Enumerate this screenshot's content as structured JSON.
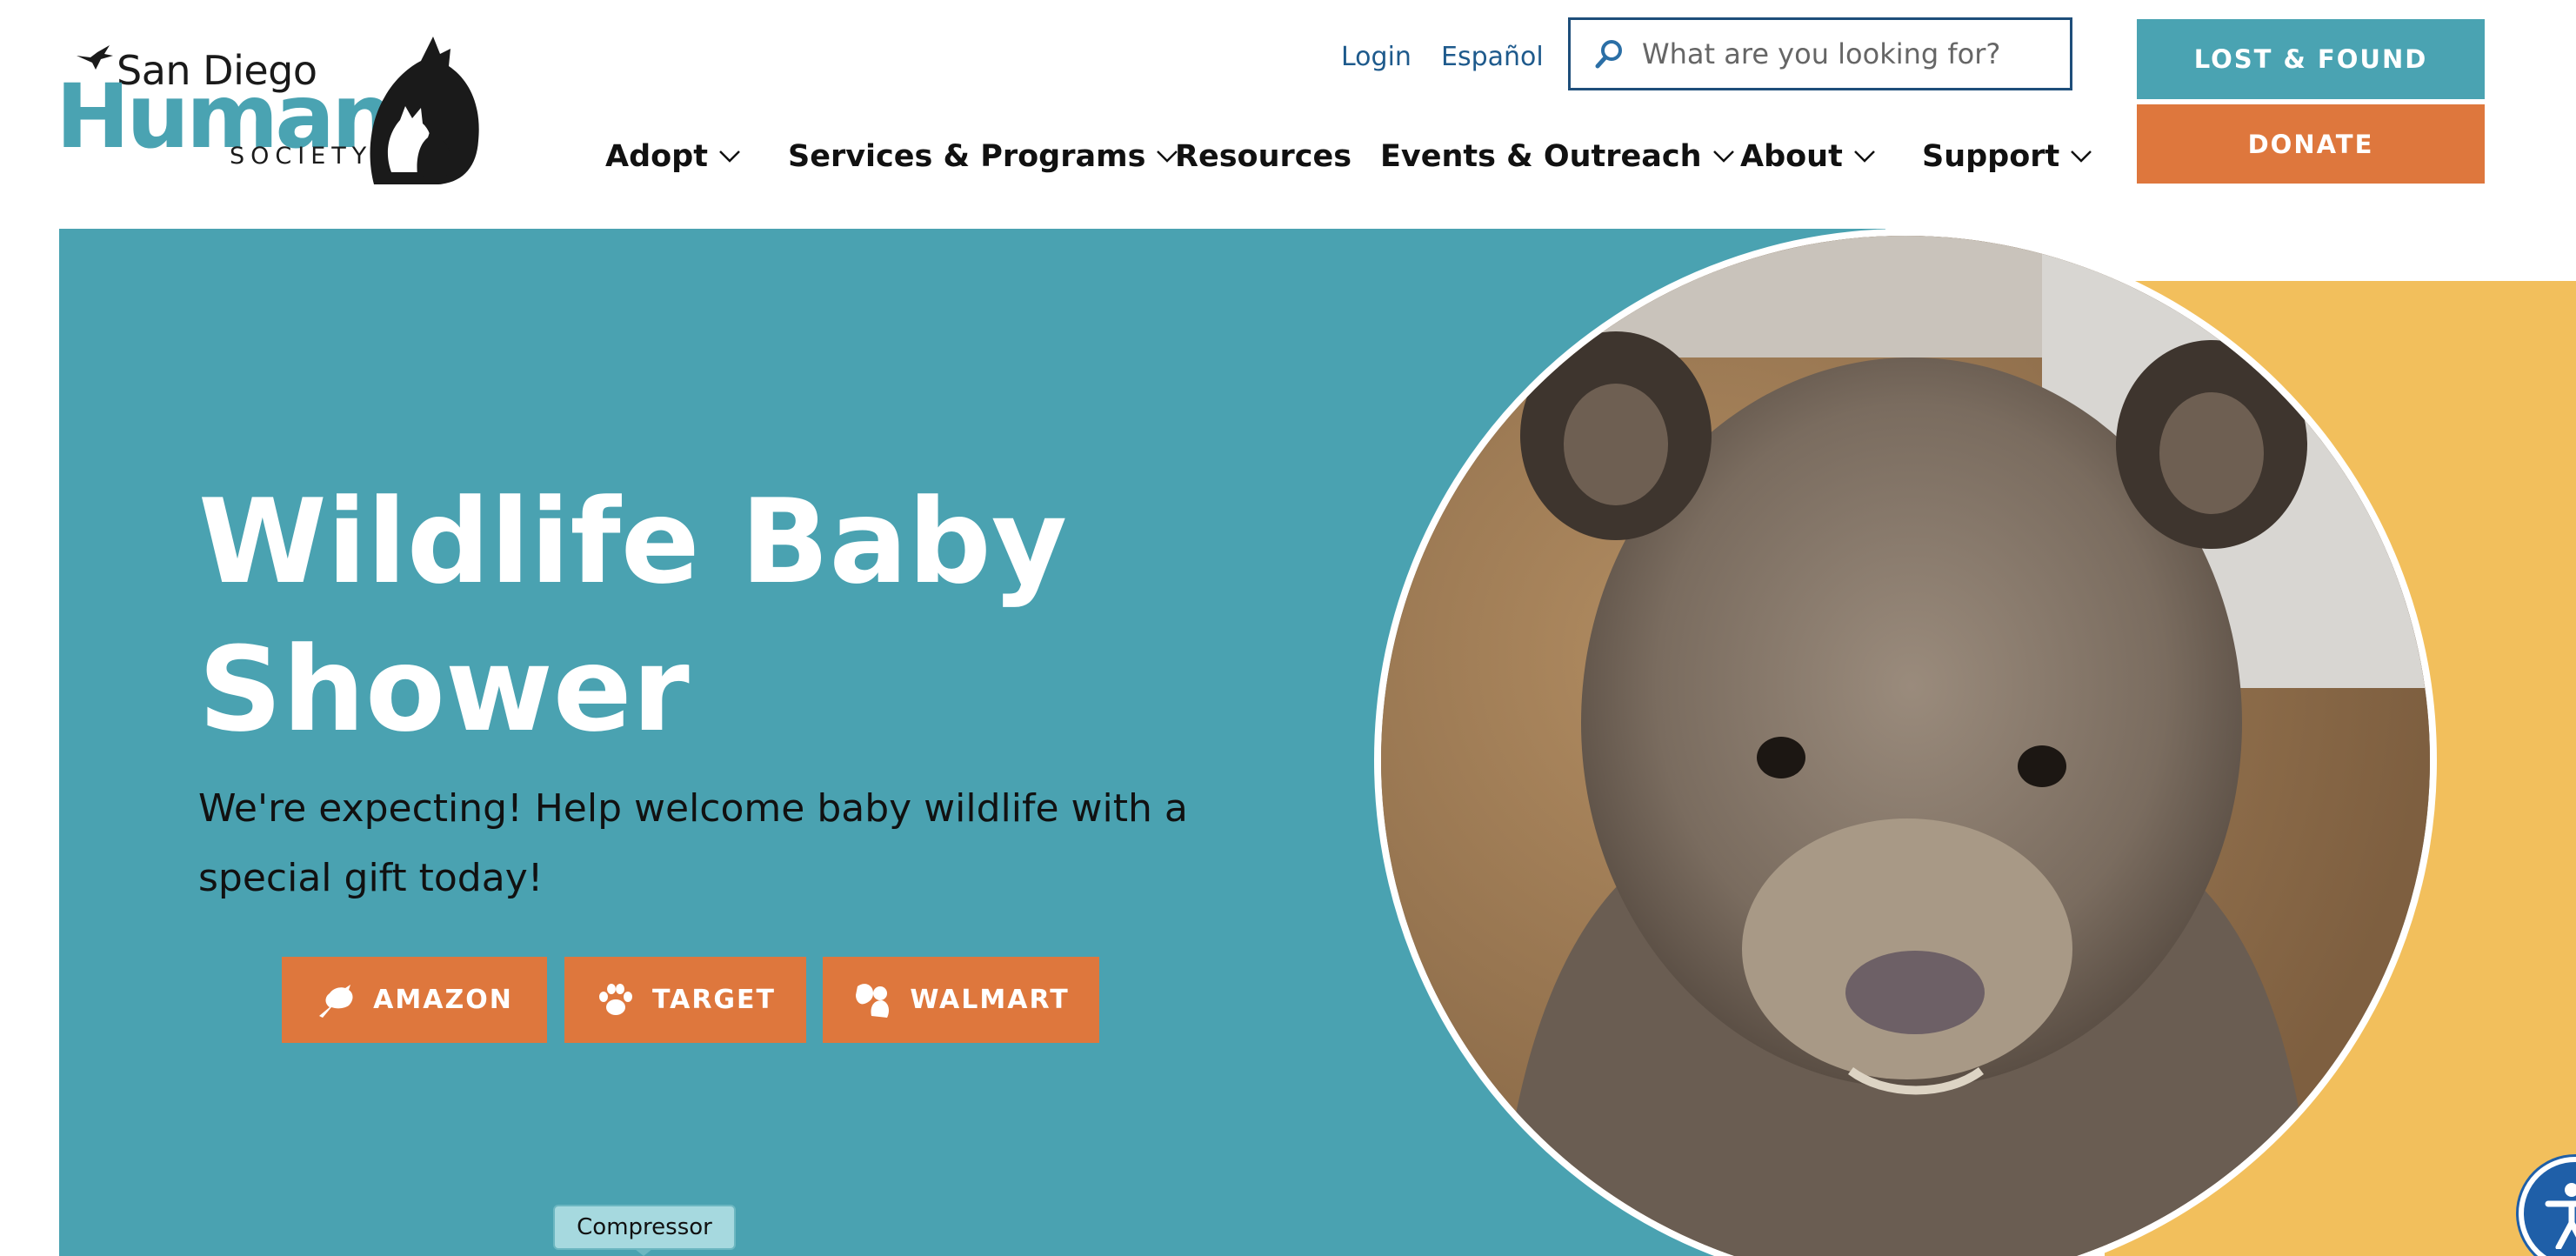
{
  "logo": {
    "line1": "San Diego",
    "line2": "Humane",
    "line3": "SOCIETY"
  },
  "header": {
    "login": "Login",
    "espanol": "Español",
    "search_placeholder": "What are you looking for?",
    "lost_found": "LOST & FOUND",
    "donate": "DONATE"
  },
  "nav": {
    "adopt": "Adopt",
    "services": "Services & Programs",
    "resources": "Resources",
    "events": "Events & Outreach",
    "about": "About",
    "support": "Support"
  },
  "hero": {
    "title": "Wildlife Baby Shower",
    "subtitle": "We're expecting! Help welcome baby wildlife with a special gift today!",
    "buttons": {
      "amazon": "AMAZON",
      "target": "TARGET",
      "walmart": "WALMART"
    }
  },
  "tooltip": "Compressor",
  "icons": {
    "search": "search-icon",
    "chevron": "chevron-down-icon",
    "amazon": "bird-icon",
    "target": "paw-icon",
    "walmart": "squirrel-icon",
    "accessibility": "accessibility-icon"
  },
  "colors": {
    "teal": "#4aa2b1",
    "orange": "#de773d",
    "yellow": "#f2bf5c",
    "navy": "#1e4e7a"
  }
}
